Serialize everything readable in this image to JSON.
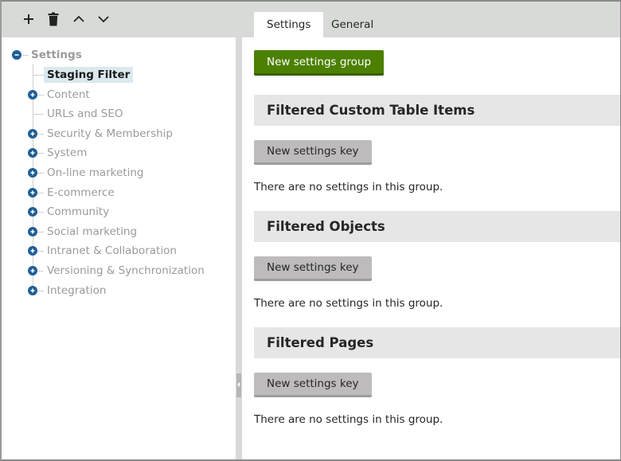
{
  "toolbar": {
    "buttons": [
      {
        "name": "add",
        "icon": "plus-icon"
      },
      {
        "name": "delete",
        "icon": "trash-icon"
      },
      {
        "name": "move-up",
        "icon": "chevron-up-icon"
      },
      {
        "name": "move-down",
        "icon": "chevron-down-icon"
      }
    ]
  },
  "tree": {
    "root": {
      "label": "Settings",
      "expanded": true
    },
    "items": [
      {
        "label": "Staging Filter",
        "expandable": false,
        "selected": true
      },
      {
        "label": "Content",
        "expandable": true
      },
      {
        "label": "URLs and SEO",
        "expandable": false
      },
      {
        "label": "Security & Membership",
        "expandable": true
      },
      {
        "label": "System",
        "expandable": true
      },
      {
        "label": "On-line marketing",
        "expandable": true
      },
      {
        "label": "E-commerce",
        "expandable": true
      },
      {
        "label": "Community",
        "expandable": true
      },
      {
        "label": "Social marketing",
        "expandable": true
      },
      {
        "label": "Intranet & Collaboration",
        "expandable": true
      },
      {
        "label": "Versioning & Synchronization",
        "expandable": true
      },
      {
        "label": "Integration",
        "expandable": true
      }
    ]
  },
  "tabs": [
    {
      "label": "Settings",
      "active": true
    },
    {
      "label": "General",
      "active": false
    }
  ],
  "main": {
    "new_group_label": "New settings group",
    "groups": [
      {
        "title": "Filtered Custom Table Items",
        "new_key_label": "New settings key",
        "empty_message": "There are no settings in this group."
      },
      {
        "title": "Filtered Objects",
        "new_key_label": "New settings key",
        "empty_message": "There are no settings in this group."
      },
      {
        "title": "Filtered Pages",
        "new_key_label": "New settings key",
        "empty_message": "There are no settings in this group."
      }
    ]
  },
  "colors": {
    "primary_button": "#4c8000",
    "tree_toggle": "#1f5f96",
    "selected_bg": "#dbe9ef",
    "header_bg": "#d8dad8",
    "group_header_bg": "#e6e6e6"
  }
}
